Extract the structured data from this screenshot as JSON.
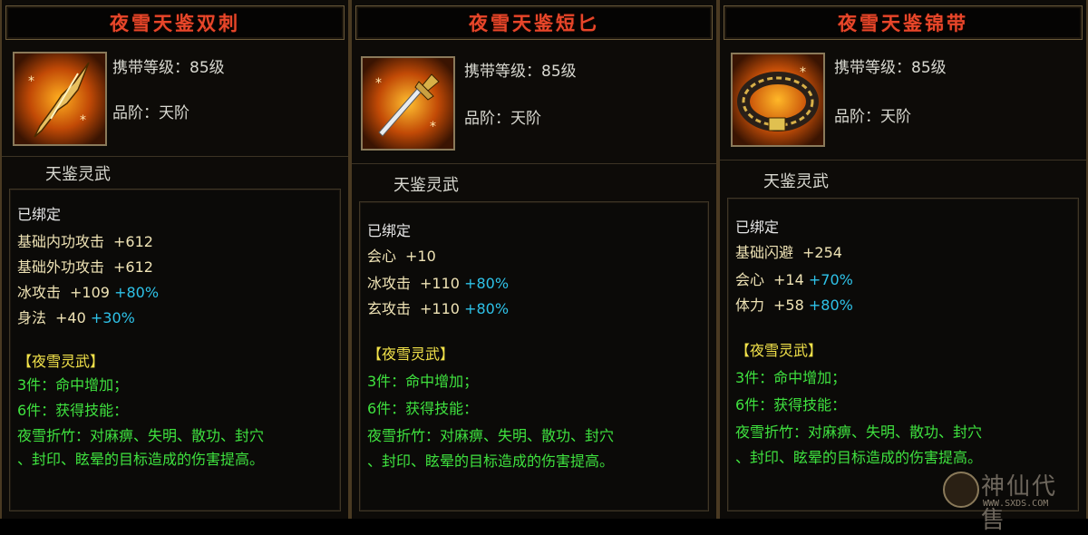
{
  "colors": {
    "title": "#e8462a",
    "bound": "#e6e6e6",
    "stat_name": "#efe3b5",
    "bonus": "#2ec2e8",
    "set_name": "#f2e24a",
    "set_effect": "#3fe23f"
  },
  "items": [
    {
      "name": "夜雪天鉴双刺",
      "icon": "twin-dagger-icon",
      "level_text": "携带等级：85级",
      "grade_text": "品阶：天阶",
      "subtitle": "天鉴灵武",
      "bound": "已绑定",
      "stats": [
        {
          "name": "基础内功攻击",
          "value": "+612",
          "bonus": ""
        },
        {
          "name": "基础外功攻击",
          "value": "+612",
          "bonus": ""
        },
        {
          "name": "冰攻击",
          "value": "+109",
          "bonus": "+80%"
        },
        {
          "name": "身法",
          "value": "+40",
          "bonus": "+30%"
        }
      ],
      "set_title": "【夜雪灵武】",
      "set_effects": [
        "3件：命中增加；",
        "6件：获得技能："
      ],
      "skill_line1": "夜雪折竹：对麻痹、失明、散功、封穴",
      "skill_line2": "、封印、眩晕的目标造成的伤害提高。"
    },
    {
      "name": "夜雪天鉴短匕",
      "icon": "short-dagger-icon",
      "level_text": "携带等级：85级",
      "grade_text": "品阶：天阶",
      "subtitle": "天鉴灵武",
      "bound": "已绑定",
      "stats": [
        {
          "name": "会心",
          "value": "+10",
          "bonus": ""
        },
        {
          "name": "冰攻击",
          "value": "+110",
          "bonus": "+80%"
        },
        {
          "name": "玄攻击",
          "value": "+110",
          "bonus": "+80%"
        }
      ],
      "set_title": "【夜雪灵武】",
      "set_effects": [
        "3件：命中增加；",
        "6件：获得技能："
      ],
      "skill_line1": "夜雪折竹：对麻痹、失明、散功、封穴",
      "skill_line2": "、封印、眩晕的目标造成的伤害提高。"
    },
    {
      "name": "夜雪天鉴锦带",
      "icon": "belt-icon",
      "level_text": "携带等级：85级",
      "grade_text": "品阶：天阶",
      "subtitle": "天鉴灵武",
      "bound": "已绑定",
      "stats": [
        {
          "name": "基础闪避",
          "value": "+254",
          "bonus": ""
        },
        {
          "name": "会心",
          "value": "+14",
          "bonus": "+70%"
        },
        {
          "name": "体力",
          "value": "+58",
          "bonus": "+80%"
        }
      ],
      "set_title": "【夜雪灵武】",
      "set_effects": [
        "3件：命中增加；",
        "6件：获得技能："
      ],
      "skill_line1": "夜雪折竹：对麻痹、失明、散功、封穴",
      "skill_line2": "、封印、眩晕的目标造成的伤害提高。"
    }
  ],
  "watermark": {
    "cn": "神仙代售",
    "url": "WWW.SXDS.COM"
  }
}
